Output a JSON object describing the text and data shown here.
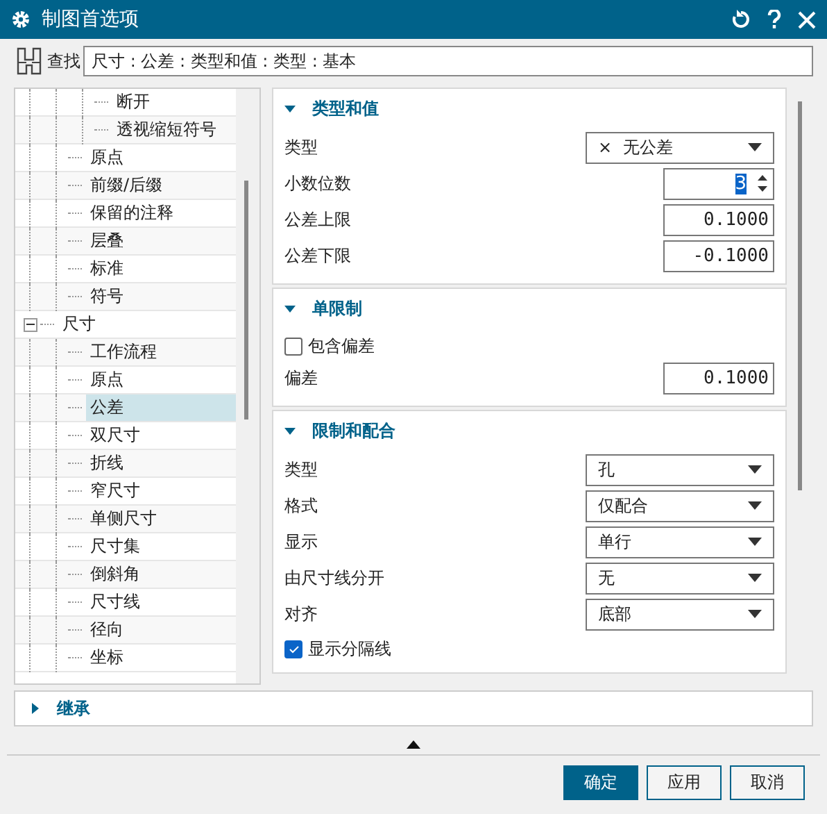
{
  "window": {
    "title": "制图首选项"
  },
  "search": {
    "label": "查找",
    "value": "尺寸 : 公差 :  类型和值 : 类型 : 基本"
  },
  "tree": {
    "items": [
      {
        "children": [
          {
            "children": [
              {
                "label": "断开",
                "selected": false
              },
              {
                "label": "透视缩短符号",
                "selected": false
              }
            ]
          },
          {
            "label": "原点",
            "selected": false
          },
          {
            "label": "前缀/后缀",
            "selected": false
          },
          {
            "label": "保留的注释",
            "selected": false
          },
          {
            "label": "层叠",
            "selected": false
          },
          {
            "label": "标准",
            "selected": false
          },
          {
            "label": "符号",
            "selected": false
          }
        ]
      },
      {
        "label": "尺寸",
        "selected": false,
        "expanded": true,
        "children": [
          {
            "label": "工作流程",
            "selected": false
          },
          {
            "label": "原点",
            "selected": false
          },
          {
            "label": "公差",
            "selected": true
          },
          {
            "label": "双尺寸",
            "selected": false
          },
          {
            "label": "折线",
            "selected": false
          },
          {
            "label": "窄尺寸",
            "selected": false
          },
          {
            "label": "单侧尺寸",
            "selected": false
          },
          {
            "label": "尺寸集",
            "selected": false
          },
          {
            "label": "倒斜角",
            "selected": false
          },
          {
            "label": "尺寸线",
            "selected": false
          },
          {
            "label": "径向",
            "selected": false
          },
          {
            "label": "坐标",
            "selected": false
          }
        ]
      }
    ]
  },
  "sections": [
    {
      "title": "类型和值",
      "expanded": true,
      "rows": [
        {
          "kind": "dropdown",
          "label": "类型",
          "value": "无公差",
          "icon": "×"
        },
        {
          "kind": "spinner",
          "label": "小数位数",
          "value": "3",
          "highlighted": true
        },
        {
          "kind": "number",
          "label": "公差上限",
          "value": "0.1000"
        },
        {
          "kind": "number",
          "label": "公差下限",
          "value": "-0.1000"
        }
      ]
    },
    {
      "title": "单限制",
      "expanded": true,
      "rows": [
        {
          "kind": "checkbox",
          "label": "包含偏差",
          "checked": false
        },
        {
          "kind": "number",
          "label": "偏差",
          "value": "0.1000"
        }
      ]
    },
    {
      "title": "限制和配合",
      "expanded": true,
      "rows": [
        {
          "kind": "dropdown",
          "label": "类型",
          "value": "孔"
        },
        {
          "kind": "dropdown",
          "label": "格式",
          "value": "仅配合"
        },
        {
          "kind": "dropdown",
          "label": "显示",
          "value": "单行"
        },
        {
          "kind": "dropdown",
          "label": "由尺寸线分开",
          "value": "无"
        },
        {
          "kind": "dropdown",
          "label": "对齐",
          "value": "底部"
        },
        {
          "kind": "checkbox",
          "label": "显示分隔线",
          "checked": true
        }
      ]
    }
  ],
  "inherit": {
    "title": "继承",
    "expanded": false
  },
  "buttons": [
    {
      "label": "确定",
      "kind": "primary"
    },
    {
      "label": "应用",
      "kind": "secondary"
    },
    {
      "label": "取消",
      "kind": "secondary"
    }
  ]
}
